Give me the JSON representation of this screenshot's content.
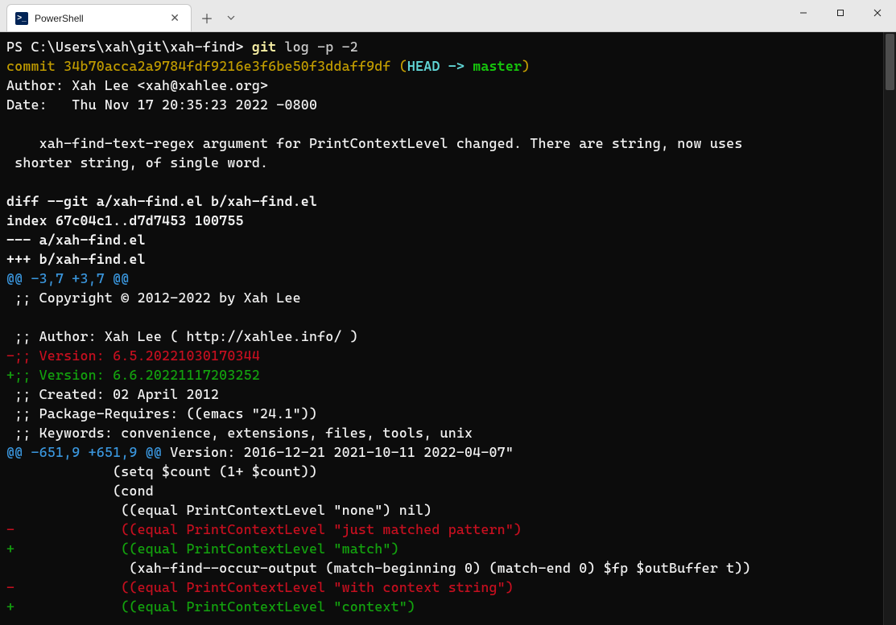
{
  "tab": {
    "icon_text": ">_",
    "title": "PowerShell"
  },
  "prompt": {
    "prefix": "PS C:\\Users\\xah\\git\\xah-find> ",
    "cmd": "git",
    "args": " log -p -2"
  },
  "commit": {
    "label": "commit ",
    "hash": "34b70acca2a9784fdf9216e3f6be50f3ddaff9df",
    "paren_open": " (",
    "head": "HEAD -> ",
    "branch": "master",
    "paren_close": ")"
  },
  "author": "Author: Xah Lee <xah@xahlee.org>",
  "date": "Date:   Thu Nov 17 20:35:23 2022 -0800",
  "msg1": "    xah-find-text-regex argument for PrintContextLevel changed. There are string, now uses",
  "msg2": " shorter string, of single word.",
  "diff_header": "diff --git a/xah-find.el b/xah-find.el",
  "index_line": "index 67c04c1..d7d7453 100755",
  "minus_file": "--- a/xah-find.el",
  "plus_file": "+++ b/xah-find.el",
  "hunk1": {
    "header": "@@ -3,7 +3,7 @@"
  },
  "ctx_copyright": " ;; Copyright © 2012-2022 by Xah Lee",
  "ctx_author": " ;; Author: Xah Lee ( http://xahlee.info/ )",
  "ver_old": "-;; Version: 6.5.20221030170344",
  "ver_new": "+;; Version: 6.6.20221117203252",
  "ctx_created": " ;; Created: 02 April 2012",
  "ctx_requires": " ;; Package-Requires: ((emacs \"24.1\"))",
  "ctx_keywords": " ;; Keywords: convenience, extensions, files, tools, unix",
  "hunk2": {
    "header": "@@ -651,9 +651,9 @@",
    "tail": " Version: 2016-12-21 2021-10-11 2022-04-07\""
  },
  "body_setq": "             (setq $count (1+ $count))",
  "body_cond": "             (cond",
  "body_none": "              ((equal PrintContextLevel \"none\") nil)",
  "rem_just": "-             ((equal PrintContextLevel \"just matched pattern\")",
  "add_match": "+             ((equal PrintContextLevel \"match\")",
  "body_occur": "               (xah-find--occur-output (match-beginning 0) (match-end 0) $fp $outBuffer t))",
  "rem_with": "-             ((equal PrintContextLevel \"with context string\")",
  "add_ctx": "+             ((equal PrintContextLevel \"context\")"
}
